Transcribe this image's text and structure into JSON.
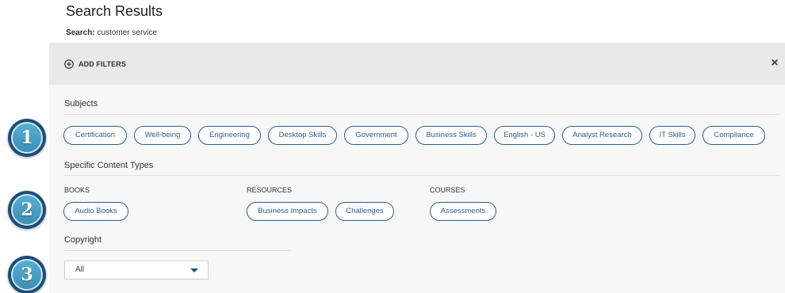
{
  "header": {
    "title": "Search Results",
    "search_label": "Search:",
    "search_query": "customer service"
  },
  "filters": {
    "add_filters_label": "ADD FILTERS",
    "close_label": "×",
    "subjects": {
      "title": "Subjects",
      "chips": [
        "Certification",
        "Well-being",
        "Engineering",
        "Desktop Skills",
        "Government",
        "Business Skills",
        "English - US",
        "Analyst Research",
        "IT Skills",
        "Compliance"
      ]
    },
    "content_types": {
      "title": "Specific Content Types",
      "books": {
        "label": "BOOKS",
        "chips": [
          "Audio Books"
        ]
      },
      "resources": {
        "label": "RESOURCES",
        "chips": [
          "Business Impacts",
          "Challenges"
        ]
      },
      "courses": {
        "label": "COURSES",
        "chips": [
          "Assessments"
        ]
      }
    },
    "copyright": {
      "title": "Copyright",
      "selected": "All"
    }
  },
  "step_badges": [
    "1",
    "2",
    "3"
  ],
  "colors": {
    "chip_border": "#2f5d8f",
    "panel_background": "#f7f7f7",
    "header_background": "#e9e9e9",
    "badge_fill": "#4a9fc6"
  }
}
